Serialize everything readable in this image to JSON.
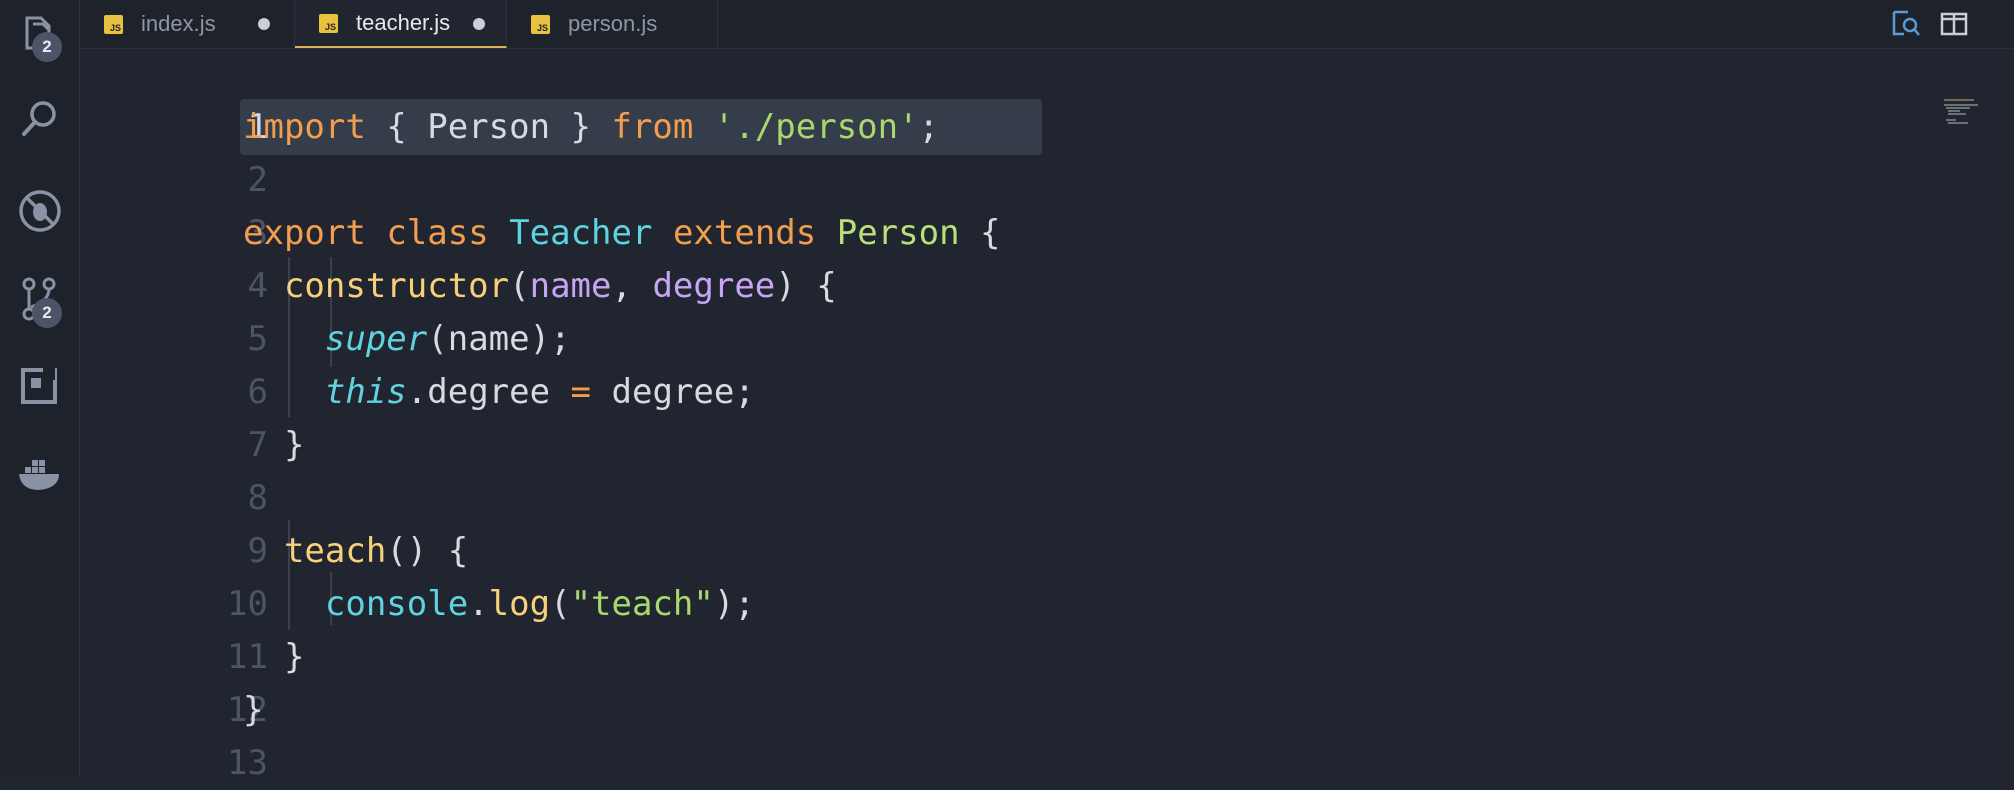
{
  "activity_bar": {
    "items": [
      {
        "name": "explorer",
        "icon": "files-icon",
        "badge": "2"
      },
      {
        "name": "search",
        "icon": "search-icon"
      },
      {
        "name": "debug",
        "icon": "no-bug-icon"
      },
      {
        "name": "source-control",
        "icon": "source-control-icon",
        "badge": "2"
      },
      {
        "name": "extensions",
        "icon": "extensions-icon"
      },
      {
        "name": "docker",
        "icon": "docker-icon"
      }
    ]
  },
  "tabs": [
    {
      "label": "index.js",
      "icon": "JS",
      "modified": true,
      "active": false
    },
    {
      "label": "teacher.js",
      "icon": "JS",
      "modified": true,
      "active": true
    },
    {
      "label": "person.js",
      "icon": "JS",
      "modified": false,
      "active": false
    }
  ],
  "toolbar": {
    "icons": [
      "open-preview-icon",
      "split-editor-icon"
    ]
  },
  "editor": {
    "line_numbers": [
      "1",
      "2",
      "3",
      "4",
      "5",
      "6",
      "7",
      "8",
      "9",
      "10",
      "11",
      "12",
      "13"
    ],
    "current_line": "1",
    "lines": [
      [
        [
          "kw",
          "import"
        ],
        [
          "plain",
          " { Person } "
        ],
        [
          "kw",
          "from"
        ],
        [
          "plain",
          " "
        ],
        [
          "str",
          "'./person'"
        ],
        [
          "plain",
          ";"
        ]
      ],
      [],
      [
        [
          "kw",
          "export"
        ],
        [
          "plain",
          " "
        ],
        [
          "kw",
          "class"
        ],
        [
          "plain",
          " "
        ],
        [
          "cls",
          "Teacher"
        ],
        [
          "plain",
          " "
        ],
        [
          "kw",
          "extends"
        ],
        [
          "plain",
          " "
        ],
        [
          "cls2",
          "Person"
        ],
        [
          "plain",
          " {"
        ]
      ],
      [
        [
          "plain",
          "  "
        ],
        [
          "fn",
          "constructor"
        ],
        [
          "plain",
          "("
        ],
        [
          "param",
          "name"
        ],
        [
          "plain",
          ", "
        ],
        [
          "param",
          "degree"
        ],
        [
          "plain",
          ") {"
        ]
      ],
      [
        [
          "plain",
          "    "
        ],
        [
          "ital",
          "super"
        ],
        [
          "plain",
          "(name);"
        ]
      ],
      [
        [
          "plain",
          "    "
        ],
        [
          "ital",
          "this"
        ],
        [
          "plain",
          ".degree "
        ],
        [
          "op",
          "="
        ],
        [
          "plain",
          " degree;"
        ]
      ],
      [
        [
          "plain",
          "  }"
        ]
      ],
      [],
      [
        [
          "plain",
          "  "
        ],
        [
          "fn",
          "teach"
        ],
        [
          "plain",
          "() {"
        ]
      ],
      [
        [
          "plain",
          "    "
        ],
        [
          "cls",
          "console"
        ],
        [
          "plain",
          "."
        ],
        [
          "fn",
          "log"
        ],
        [
          "plain",
          "("
        ],
        [
          "str",
          "\"teach\""
        ],
        [
          "plain",
          ");"
        ]
      ],
      [
        [
          "plain",
          "  }"
        ]
      ],
      [
        [
          "plain",
          "}"
        ]
      ],
      []
    ]
  },
  "colors": {
    "background": "#21252f",
    "keyword": "#f19e4e",
    "string": "#a8d86e",
    "class": "#5fd3e0",
    "function": "#f6d07a",
    "parameter": "#c8a4f4",
    "tab_accent": "#d8b35a"
  }
}
